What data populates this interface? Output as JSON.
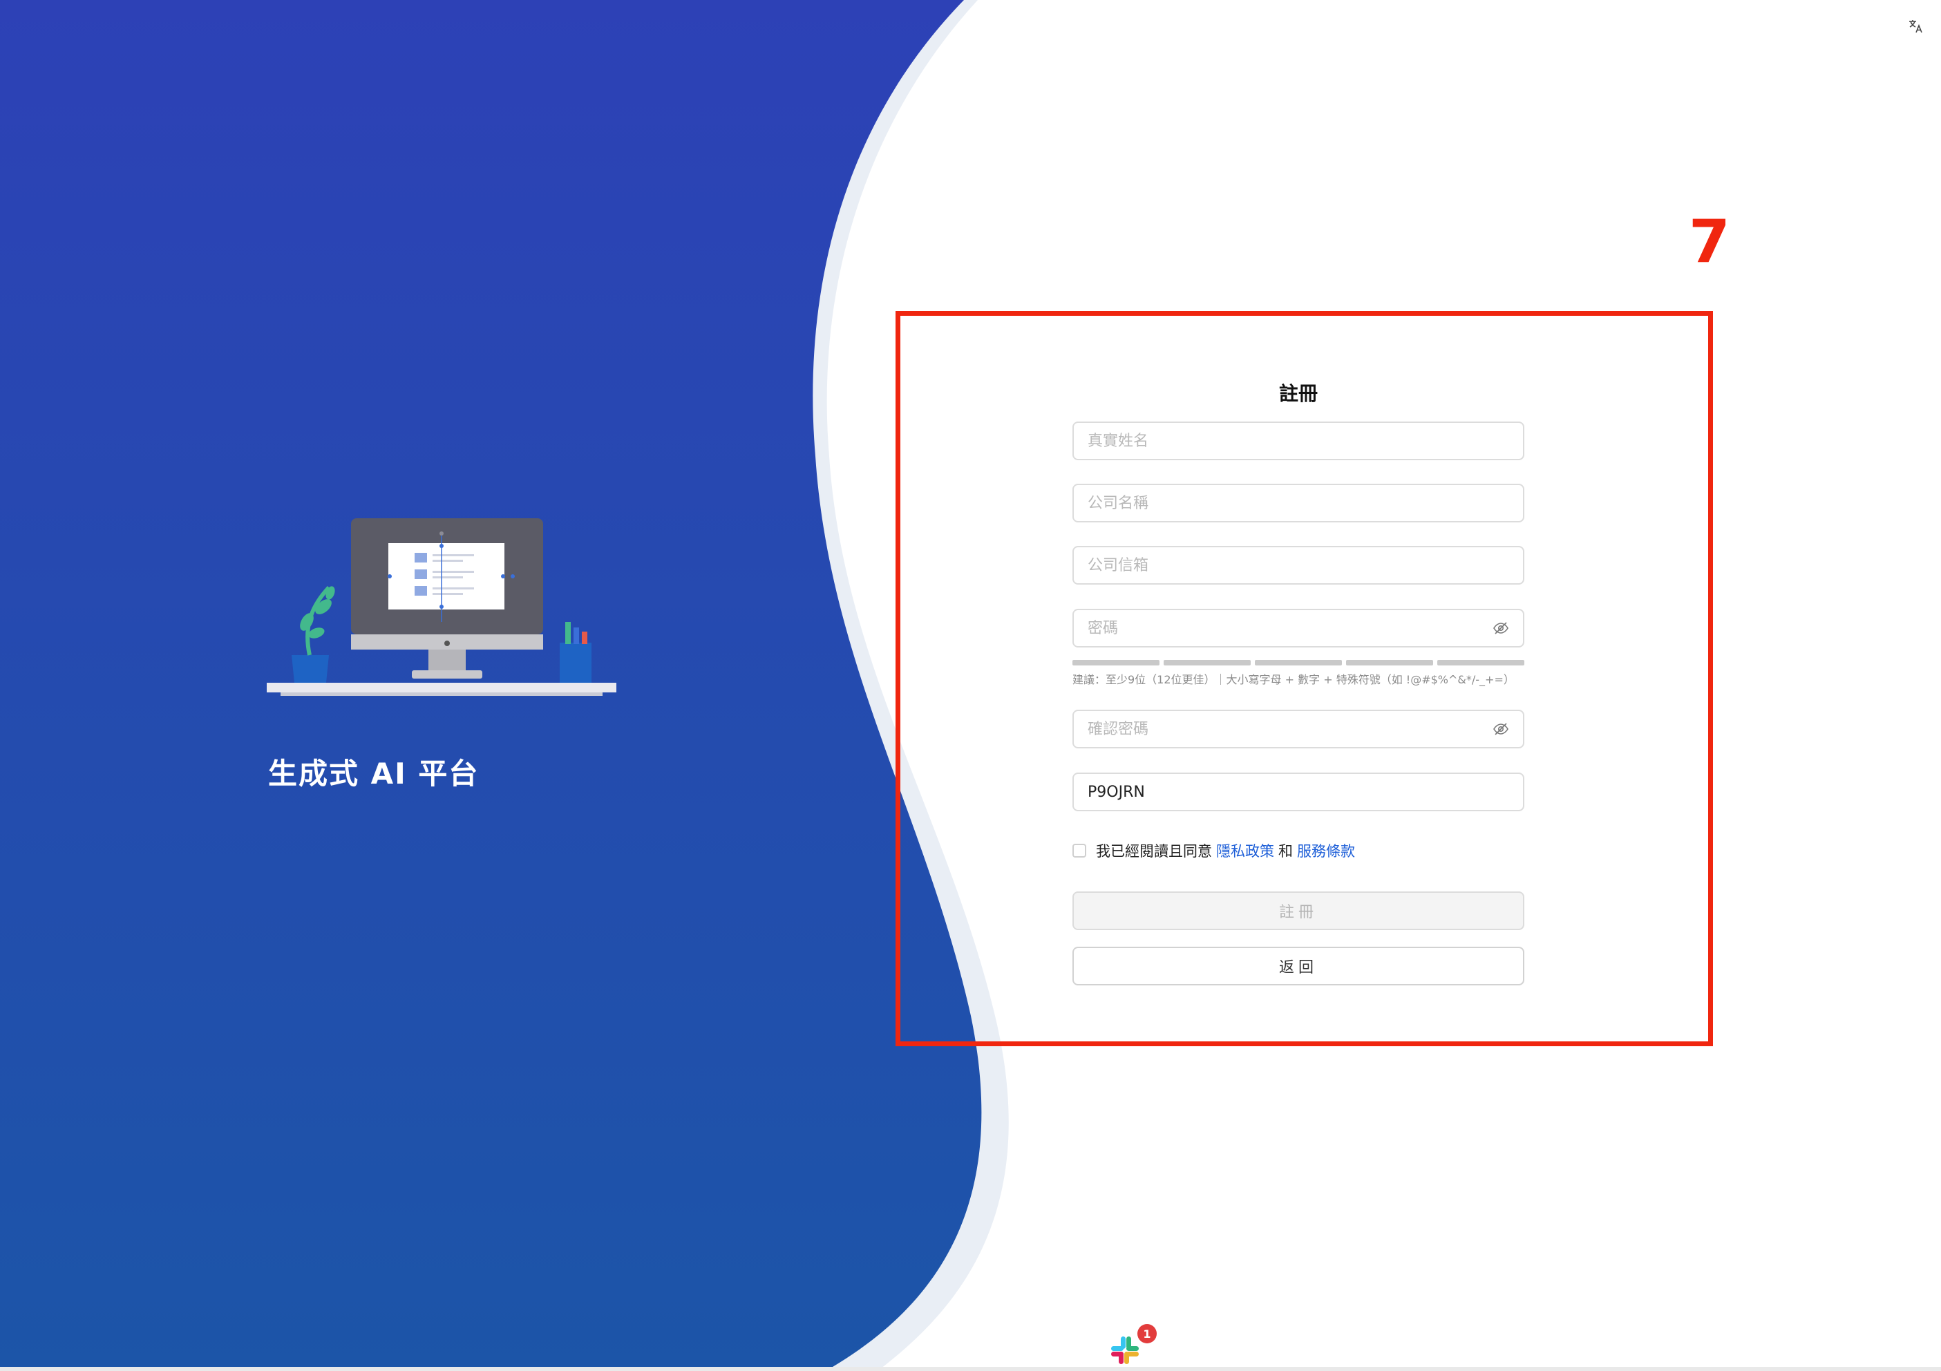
{
  "brand": {
    "title": "生成式 AI 平台"
  },
  "annotation": {
    "number": "7",
    "color": "#f0260f"
  },
  "form": {
    "title": "註冊",
    "fields": {
      "real_name": {
        "placeholder": "真實姓名",
        "value": ""
      },
      "company_name": {
        "placeholder": "公司名稱",
        "value": ""
      },
      "company_email": {
        "placeholder": "公司信箱",
        "value": ""
      },
      "password": {
        "placeholder": "密碼",
        "value": ""
      },
      "confirm_password": {
        "placeholder": "確認密碼",
        "value": ""
      },
      "invite_code": {
        "placeholder": "",
        "value": "P9OJRN"
      }
    },
    "password_hint": "建議：至少9位（12位更佳）｜大小寫字母 + 數字 + 特殊符號（如 !@#$%^&*/-_+=）",
    "agree": {
      "prefix": "我已經閱讀且同意",
      "privacy_link": "隱私政策",
      "and": "和",
      "terms_link": "服務條款",
      "checked": false
    },
    "register_button": "註冊",
    "back_button": "返回"
  },
  "dock": {
    "slack_badge": "1"
  },
  "colors": {
    "background_top": "#2d41b6",
    "background_bottom": "#1c55a8",
    "link": "#1e5fd8",
    "annotation": "#f0260f"
  }
}
